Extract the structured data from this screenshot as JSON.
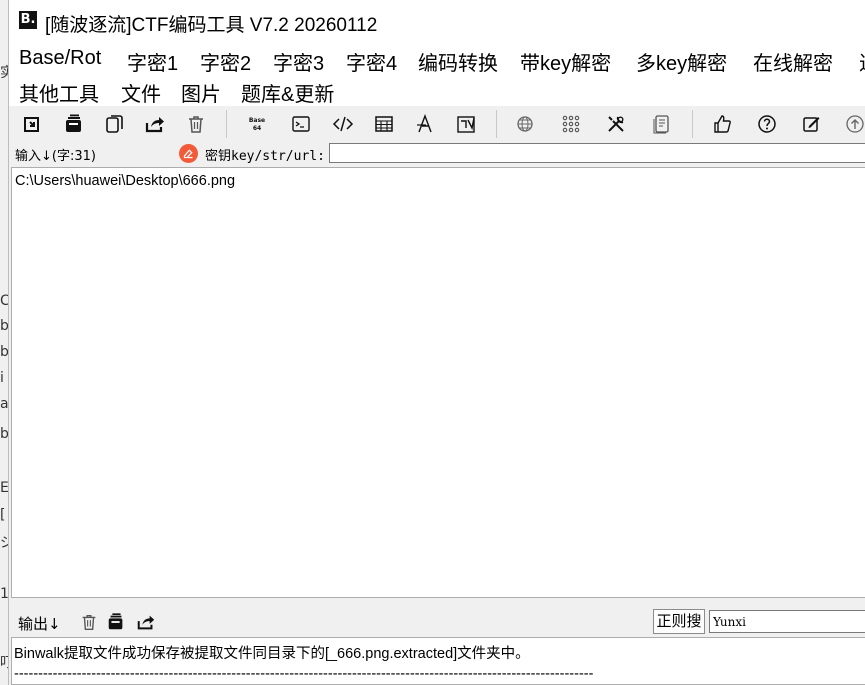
{
  "background_window": {
    "fragments": [
      "实",
      "C",
      "b",
      "b",
      "i",
      "a",
      "b",
      "E",
      "[",
      "ジ",
      "1",
      "叮"
    ]
  },
  "window": {
    "logo_text": "B.",
    "title": "[随波逐流]CTF编码工具 V7.2  20260112"
  },
  "menu": {
    "items": [
      "Base/Rot",
      "字密1",
      "字密2",
      "字密3",
      "字密4",
      "编码转换",
      "带key解密",
      "多key解密",
      "在线解密",
      "进",
      "其他工具",
      "文件",
      "图片",
      "题库&更新"
    ]
  },
  "toolbar": {
    "icons": [
      "import-icon",
      "copy-stack-icon",
      "paste-icon",
      "share-icon",
      "trash-icon",
      "base64-icon",
      "terminal-icon",
      "code-icon",
      "table-icon",
      "font-a-icon",
      "signature-icon",
      "globe-icon",
      "grid-icon",
      "tools-icon",
      "document-icon",
      "thumbs-up-icon",
      "help-icon",
      "edit-icon",
      "upload-icon"
    ],
    "base_icon_text": "Base",
    "base_icon_num": "64"
  },
  "input": {
    "label": "输入↓(字:31)",
    "key_label": "密钥key/str/url:",
    "key_value": "",
    "content": "C:\\Users\\huawei\\Desktop\\666.png"
  },
  "output": {
    "label": "输出↓",
    "regex_button": "正则搜",
    "search_value": "Yunxi",
    "lines": [
      "Binwalk提取文件成功保存被提取文件同目录下的[_666.png.extracted]文件夹中。",
      "------------------------------------------------------------------------------------------------------------------------"
    ]
  },
  "colors": {
    "key_icon": "#f25b3a",
    "window_bg": "#f0f0f0",
    "menu_bg": "#ffffff"
  }
}
